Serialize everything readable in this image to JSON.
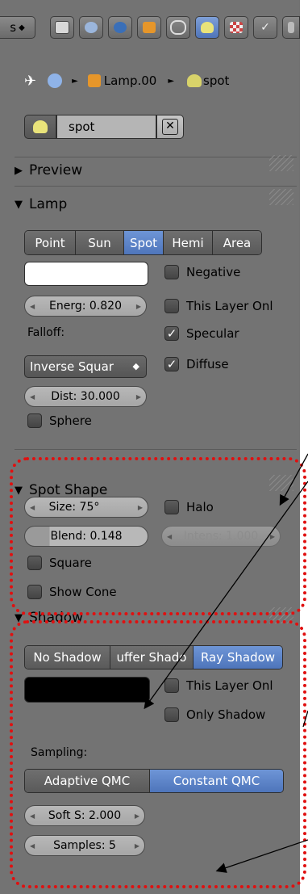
{
  "toolbar": {
    "left_partial": "s",
    "icons": [
      "render-icon",
      "render-layers-icon",
      "scene-icon",
      "world-icon",
      "object-icon",
      "constraints-icon",
      "lamp-data-icon",
      "texture-icon",
      "particles-icon"
    ]
  },
  "breadcrumb": {
    "object": "Lamp.00",
    "data": "spot"
  },
  "datablock": {
    "name": "spot"
  },
  "sections": {
    "preview": "Preview",
    "lamp": "Lamp",
    "spot_shape": "Spot Shape",
    "shadow": "Shadow"
  },
  "lamp": {
    "types": [
      "Point",
      "Sun",
      "Spot",
      "Hemi",
      "Area"
    ],
    "selected_type": "Spot",
    "color": "#ffffff",
    "energy": "Energ: 0.820",
    "falloff_label": "Falloff:",
    "falloff_value": "Inverse Squar",
    "distance": "Dist: 30.000",
    "sphere": "Sphere",
    "negative": "Negative",
    "this_layer": "This Layer Onl",
    "specular": "Specular",
    "diffuse": "Diffuse"
  },
  "spot": {
    "size": "Size: 75°",
    "blend": "Blend: 0.148",
    "halo": "Halo",
    "intensity": "Intens: 1.000",
    "square": "Square",
    "show_cone": "Show Cone"
  },
  "shadow": {
    "modes": [
      "No Shadow",
      "uffer Shado",
      "Ray Shadow"
    ],
    "selected_mode": "Ray Shadow",
    "color": "#000000",
    "this_layer": "This Layer Onl",
    "only_shadow": "Only Shadow",
    "sampling_label": "Sampling:",
    "sampling_modes": [
      "Adaptive QMC",
      "Constant QMC"
    ],
    "selected_sampling": "Constant QMC",
    "soft_size": "Soft S: 2.000",
    "samples": "Samples: 5"
  },
  "colors": {
    "highlight": "#e01010",
    "accent": "#5680c2"
  }
}
